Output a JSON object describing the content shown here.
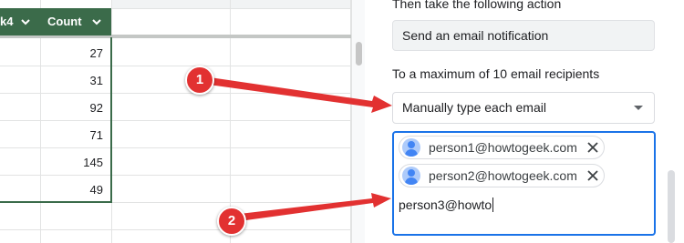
{
  "spreadsheet": {
    "header_prev_fragment": "k4",
    "header_count_label": "Count",
    "count_values": [
      "27",
      "31",
      "92",
      "71",
      "145",
      "49"
    ]
  },
  "panel": {
    "heading_partial": "Then take the following action",
    "action_value": "Send an email notification",
    "recipients_label": "To a maximum of 10 email recipients",
    "recipients_mode": "Manually type each email",
    "chips": [
      "person1@howtogeek.com",
      "person2@howtogeek.com"
    ],
    "typed_input": "person3@howto"
  },
  "callouts": [
    "1",
    "2"
  ],
  "colors": {
    "header_green": "#3b6b4a",
    "focus_blue": "#1a73e8",
    "callout_red": "#e23131"
  },
  "icons": [
    "chevron-down-icon",
    "dropdown-arrow-icon",
    "person-avatar-icon",
    "close-icon"
  ]
}
